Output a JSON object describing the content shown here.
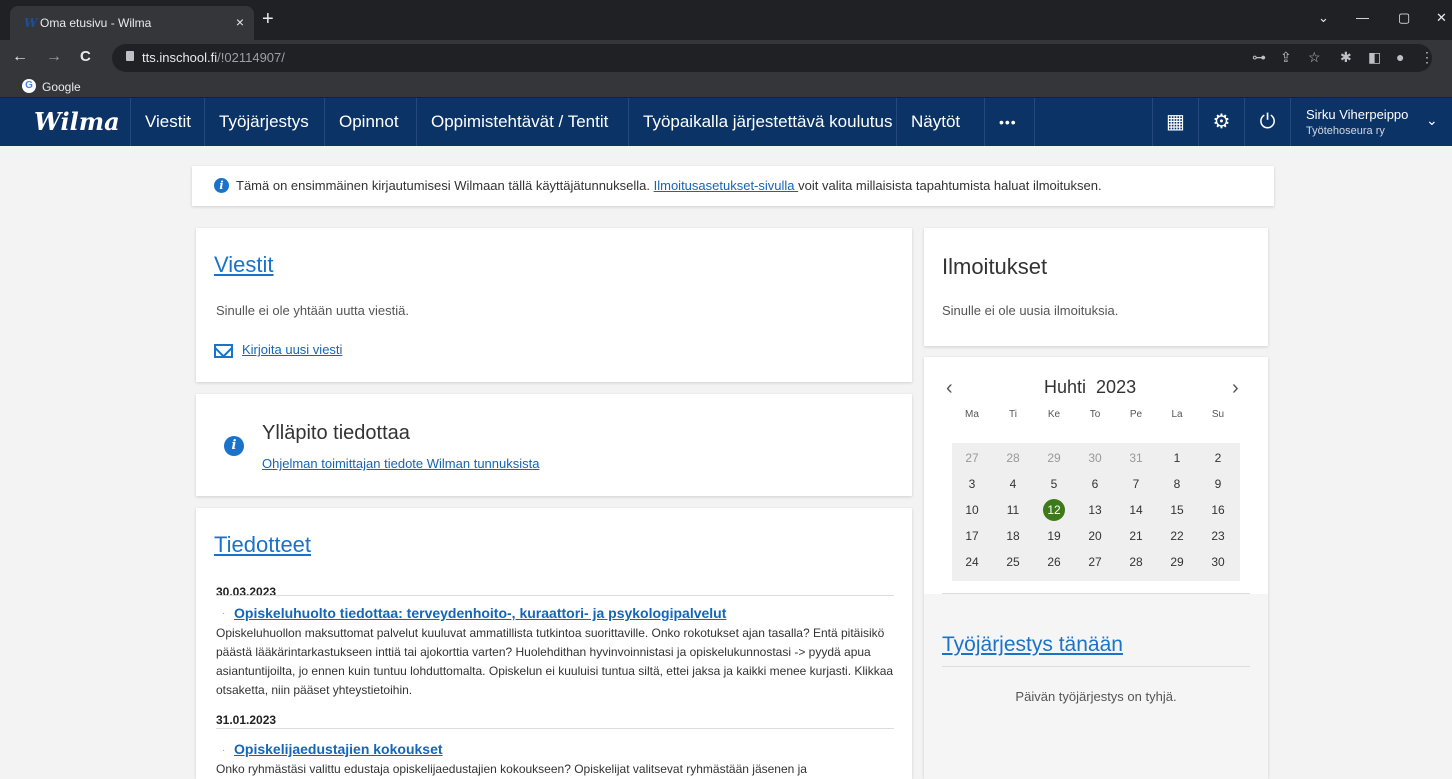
{
  "browser": {
    "tab_title": "Oma etusivu - Wilma",
    "tab_favicon": "W",
    "tab_close": "×",
    "new_tab": "+",
    "url_host": "tts.inschool.fi",
    "url_path": "/!02114907/",
    "bookmark_label": "Google",
    "bookmark_icon": "G",
    "nav_back": "←",
    "nav_forward": "→",
    "nav_reload": "C",
    "win_minimize": "—",
    "win_restore": "▢",
    "win_close": "✕",
    "win_chevron": "⌄",
    "omni_key_icon": "⊶",
    "omni_share_icon": "⇪",
    "omni_star_icon": "☆",
    "omni_ext_icon": "✱",
    "omni_panel_icon": "◧",
    "omni_profile_icon": "●",
    "omni_menu_icon": "⋮"
  },
  "nav": {
    "logo": "Wilma",
    "items": [
      {
        "label": "Viestit"
      },
      {
        "label": "Työjärjestys"
      },
      {
        "label": "Opinnot"
      },
      {
        "label": "Oppimistehtävät / Tentit"
      },
      {
        "label": "Työpaikalla järjestettävä koulutus"
      },
      {
        "label": "Näytöt"
      },
      {
        "label": "•••"
      }
    ],
    "qr_icon": "▦",
    "settings_icon": "⚙",
    "power_icon": "⏻",
    "user_name": "Sirku Viherpeippo",
    "user_org": "Työtehoseura ry",
    "user_chevron": "⌄"
  },
  "notice": {
    "icon": "i",
    "before": "Tämä on ensimmäinen kirjautumisesi Wilmaan tällä käyttäjätunnuksella. ",
    "link": "Ilmoitusasetukset-sivulla ",
    "after": "voit valita millaisista tapahtumista haluat ilmoituksen."
  },
  "messages": {
    "title": "Viestit",
    "empty": "Sinulle ei ole yhtään uutta viestiä.",
    "new_link": "Kirjoita uusi viesti"
  },
  "maintenance": {
    "icon": "i",
    "title": "Ylläpito tiedottaa",
    "link": "Ohjelman toimittajan tiedote Wilman tunnuksista"
  },
  "news": {
    "title": "Tiedotteet",
    "items": [
      {
        "date": "30.03.2023",
        "bullet": "·",
        "headline": "Opiskeluhuolto tiedottaa: terveydenhoito-, kuraattori- ja psykologipalvelut",
        "body": "Opiskeluhuollon maksuttomat palvelut kuuluvat ammatillista tutkintoa suorittaville. Onko rokotukset ajan tasalla? Entä pitäisikö päästä lääkärintarkastukseen inttiä tai ajokorttia varten? Huolehdithan hyvinvoinnistasi ja opiskelukunnostasi -> pyydä apua asiantuntijoilta, jo ennen kuin tuntuu lohduttomalta. Opiskelun ei kuuluisi tuntua siltä, ettei jaksa ja kaikki menee kurjasti. Klikkaa otsaketta, niin pääset yhteystietoihin."
      },
      {
        "date": "31.01.2023",
        "bullet": "·",
        "headline": "Opiskelijaedustajien kokoukset",
        "body": "Onko ryhmästäsi valittu edustaja opiskelijaedustajien kokoukseen? Opiskelijat valitsevat ryhmästään jäsenen ja"
      }
    ]
  },
  "notifications": {
    "title": "Ilmoitukset",
    "empty": "Sinulle ei ole uusia ilmoituksia."
  },
  "calendar": {
    "month": "Huhti",
    "year": "2023",
    "prev": "‹",
    "next": "›",
    "weekdays": [
      "Ma",
      "Ti",
      "Ke",
      "To",
      "Pe",
      "La",
      "Su"
    ],
    "weeks": [
      [
        {
          "d": "27",
          "o": true
        },
        {
          "d": "28",
          "o": true
        },
        {
          "d": "29",
          "o": true
        },
        {
          "d": "30",
          "o": true
        },
        {
          "d": "31",
          "o": true
        },
        {
          "d": "1"
        },
        {
          "d": "2"
        }
      ],
      [
        {
          "d": "3"
        },
        {
          "d": "4"
        },
        {
          "d": "5"
        },
        {
          "d": "6"
        },
        {
          "d": "7"
        },
        {
          "d": "8"
        },
        {
          "d": "9"
        }
      ],
      [
        {
          "d": "10"
        },
        {
          "d": "11"
        },
        {
          "d": "12",
          "today": true
        },
        {
          "d": "13"
        },
        {
          "d": "14"
        },
        {
          "d": "15"
        },
        {
          "d": "16"
        }
      ],
      [
        {
          "d": "17"
        },
        {
          "d": "18"
        },
        {
          "d": "19"
        },
        {
          "d": "20"
        },
        {
          "d": "21"
        },
        {
          "d": "22"
        },
        {
          "d": "23"
        }
      ],
      [
        {
          "d": "24"
        },
        {
          "d": "25"
        },
        {
          "d": "26"
        },
        {
          "d": "27"
        },
        {
          "d": "28"
        },
        {
          "d": "29"
        },
        {
          "d": "30"
        }
      ]
    ],
    "today_color": "#3c7a1a"
  },
  "schedule": {
    "title": "Työjärjestys tänään",
    "empty": "Päivän työjärjestys on tyhjä."
  },
  "colors": {
    "nav_bg": "#0c3366",
    "link": "#1565b8",
    "accent": "#1a73c9"
  }
}
